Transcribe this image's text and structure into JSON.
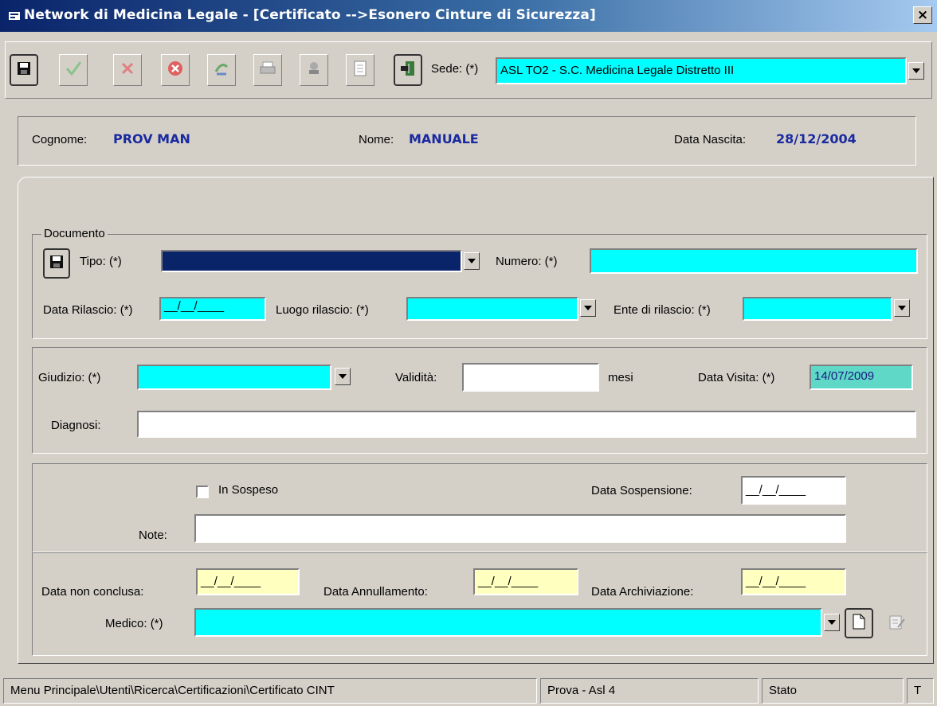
{
  "window": {
    "title": "Network di Medicina Legale - [Certificato -->Esonero Cinture di Sicurezza]",
    "close_glyph": "×"
  },
  "toolbar": {
    "sede_label": "Sede: (*)",
    "sede_value": "ASL TO2 - S.C. Medicina Legale Distretto III",
    "icons": [
      "save-icon",
      "confirm-check-icon",
      "cancel-x-icon",
      "stop-icon",
      "refresh-icon",
      "print-icon",
      "stamp-icon",
      "document-icon",
      "exit-icon"
    ]
  },
  "patient": {
    "cognome_label": "Cognome:",
    "cognome_value": "PROV MAN",
    "nome_label": "Nome:",
    "nome_value": "MANUALE",
    "nascita_label": "Data Nascita:",
    "nascita_value": "28/12/2004"
  },
  "documento": {
    "legend": "Documento",
    "tipo_label": "Tipo: (*)",
    "tipo_value": "",
    "numero_label": "Numero: (*)",
    "numero_value": "",
    "rilascio_label": "Data Rilascio: (*)",
    "rilascio_value": "__/__/____",
    "luogo_label": "Luogo rilascio: (*)",
    "luogo_value": "",
    "ente_label": "Ente di rilascio: (*)",
    "ente_value": ""
  },
  "giudizio": {
    "giudizio_label": "Giudizio: (*)",
    "giudizio_value": "",
    "validita_label": "Validità:",
    "validita_value": "",
    "mesi_label": "mesi",
    "visita_label": "Data Visita: (*)",
    "visita_value": "14/07/2009",
    "diagnosi_label": "Diagnosi:",
    "diagnosi_value": ""
  },
  "sospensione": {
    "insospeso_label": "In Sospeso",
    "data_sosp_label": "Data Sospensione:",
    "data_sosp_value": "__/__/____",
    "note_label": "Note:",
    "note_value": ""
  },
  "date": {
    "nonconclusa_label": "Data non conclusa:",
    "nonconclusa_value": "__/__/____",
    "annullamento_label": "Data Annullamento:",
    "annullamento_value": "__/__/____",
    "archiviazione_label": "Data Archiviazione:",
    "archiviazione_value": "__/__/____",
    "medico_label": "Medico: (*)",
    "medico_value": ""
  },
  "statusbar": {
    "path": "Menu Principale\\Utenti\\Ricerca\\Certificazioni\\Certificato CINT",
    "user": "Prova - Asl 4",
    "stato": "Stato",
    "t": "T"
  },
  "colors": {
    "required_field": "#00ffff",
    "date_field": "#ffffc0",
    "patient_value": "#1a2aa0",
    "title_bar": "#0a246a"
  }
}
